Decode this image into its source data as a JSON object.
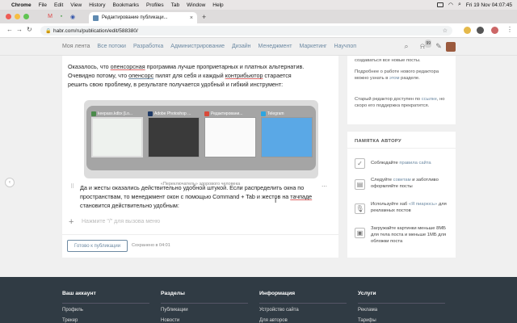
{
  "menubar": {
    "apple": "",
    "items": [
      "Chrome",
      "File",
      "Edit",
      "View",
      "History",
      "Bookmarks",
      "Profiles",
      "Tab",
      "Window",
      "Help"
    ],
    "clock": "Fri 19 Nov 04:07:45"
  },
  "browser": {
    "tab_title": "Редактирование публикаци...",
    "tab_close": "×",
    "new_tab": "+",
    "url": "habr.com/ru/publication/edit/588380/",
    "back": "←",
    "forward": "→",
    "reload": "↻",
    "star": "☆",
    "menu": "⋮"
  },
  "habr_nav": {
    "items": [
      "Моя лента",
      "Все потоки",
      "Разработка",
      "Администрирование",
      "Дизайн",
      "Менеджмент",
      "Маркетинг",
      "Научпоп"
    ],
    "notifications_count": "99"
  },
  "article": {
    "p1_before": "Оказалось, что ",
    "p1_u1": "опенсорсная",
    "p1_mid": " программа лучше проприетарных и платных альтернатив. Очевидно потому, что ",
    "p1_u2": "опенсорс",
    "p1_mid2": " пилят для себя и каждый ",
    "p1_u3": "контрибьютор",
    "p1_after": " старается решить свою проблему, в результате получается удобный и гибкий инструмент:",
    "figure_caption": "«Переключатель» здорового человека",
    "windows": [
      {
        "title": "keepass.kdbx [Lo...",
        "color": "#4a8a4a"
      },
      {
        "title": "Adobe Photoshop ...",
        "color": "#1f3a66"
      },
      {
        "title": "Редактировани...",
        "color": "#d84a3a"
      },
      {
        "title": "Telegram",
        "color": "#2ea5e0"
      }
    ],
    "p2_before": "Да и жесты оказались действительно удобной штукой. Если распределить окна по пространствам, то менеджмент окон с помощью Command + Tab и жестов на ",
    "p2_u": "тачпаде",
    "p2_after": " становится действительно удобным:",
    "placeholder": "Нажмите \"/\" для вызова меню",
    "publish_button": "Готово к публикации",
    "saved_status": "Сохранено в 04:01"
  },
  "sidebar": {
    "note_top": "создаваться все новые посты.",
    "note_new_editor_1": "Подробнее о работе нового редактора можно узнать в ",
    "note_new_editor_link": "этом",
    "note_new_editor_2": " разделе.",
    "note_old_editor_1": "Старый редактор доступен по ",
    "note_old_editor_link": "ссылке",
    "note_old_editor_2": ", но скоро его поддержка прекратится.",
    "memo_title": "ПАМЯТКА АВТОРУ",
    "rules": [
      {
        "pre": "Соблюдайте ",
        "link": "правила сайта",
        "post": "",
        "icon": "✓"
      },
      {
        "pre": "Следуйте ",
        "link": "советам",
        "post": " и заботливо оформляйте посты",
        "icon": "▤"
      },
      {
        "pre": "Используйте хаб ",
        "link": "«Я пиарюсь»",
        "post": " для рекламных постов",
        "icon": "🎙"
      },
      {
        "pre": "Загружайте картинки меньше 8МБ для тела поста и меньше 1МБ для обложки поста",
        "link": "",
        "post": "",
        "icon": "▣"
      }
    ]
  },
  "footer": {
    "cols": [
      {
        "title": "Ваш аккаунт",
        "l1": "Профиль",
        "l2": "Трекер"
      },
      {
        "title": "Разделы",
        "l1": "Публикации",
        "l2": "Новости"
      },
      {
        "title": "Информация",
        "l1": "Устройство сайта",
        "l2": "Для авторов"
      },
      {
        "title": "Услуги",
        "l1": "Реклама",
        "l2": "Тарифы"
      }
    ]
  }
}
